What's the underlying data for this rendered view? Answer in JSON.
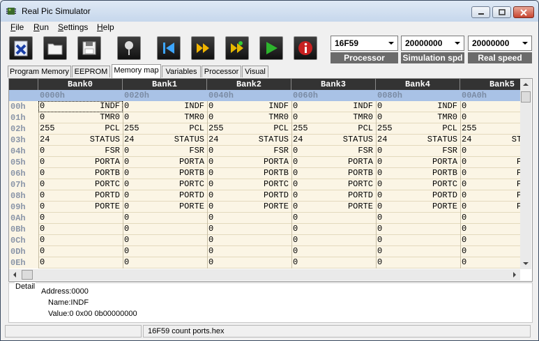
{
  "window": {
    "title": "Real Pic Simulator"
  },
  "menu": [
    {
      "label": "File",
      "accel": "F",
      "rest": "ile"
    },
    {
      "label": "Run",
      "accel": "R",
      "rest": "un"
    },
    {
      "label": "Settings",
      "accel": "S",
      "rest": "ettings"
    },
    {
      "label": "Help",
      "accel": "H",
      "rest": "elp"
    }
  ],
  "toolbar": {
    "buttons": [
      {
        "icon": "close-file-icon"
      },
      {
        "icon": "open-folder-icon"
      },
      {
        "icon": "save-icon"
      },
      {
        "icon": "breakpoint-pin-icon"
      },
      {
        "icon": "reset-icon"
      },
      {
        "icon": "step-forward-icon"
      },
      {
        "icon": "step-over-icon"
      },
      {
        "icon": "run-icon"
      },
      {
        "icon": "info-icon"
      }
    ],
    "processor": {
      "value": "16F59",
      "label": "Processor"
    },
    "sim_speed": {
      "value": "20000000",
      "label": "Simulation spd"
    },
    "real_speed": {
      "value": "20000000",
      "label": "Real speed"
    }
  },
  "tabs": [
    "Program Memory",
    "EEPROM",
    "Memory map",
    "Variables",
    "Processor",
    "Visual"
  ],
  "active_tab": "Memory map",
  "memory_map": {
    "banks": [
      "Bank0",
      "Bank1",
      "Bank2",
      "Bank3",
      "Bank4",
      "Bank5"
    ],
    "bank_addresses": [
      "0000h",
      "0020h",
      "0040h",
      "0060h",
      "0080h",
      "00A0h"
    ],
    "rows": [
      {
        "addr": "00h",
        "value": "0",
        "name": "INDF"
      },
      {
        "addr": "01h",
        "value": "0",
        "name": "TMR0"
      },
      {
        "addr": "02h",
        "value": "255",
        "name": "PCL"
      },
      {
        "addr": "03h",
        "value": "24",
        "name": "STATUS"
      },
      {
        "addr": "04h",
        "value": "0",
        "name": "FSR"
      },
      {
        "addr": "05h",
        "value": "0",
        "name": "PORTA"
      },
      {
        "addr": "06h",
        "value": "0",
        "name": "PORTB"
      },
      {
        "addr": "07h",
        "value": "0",
        "name": "PORTC"
      },
      {
        "addr": "08h",
        "value": "0",
        "name": "PORTD"
      },
      {
        "addr": "09h",
        "value": "0",
        "name": "PORTE"
      },
      {
        "addr": "0Ah",
        "value": "0",
        "name": ""
      },
      {
        "addr": "0Bh",
        "value": "0",
        "name": ""
      },
      {
        "addr": "0Ch",
        "value": "0",
        "name": ""
      },
      {
        "addr": "0Dh",
        "value": "0",
        "name": ""
      },
      {
        "addr": "0Eh",
        "value": "0",
        "name": ""
      }
    ]
  },
  "detail": {
    "title": "Detail",
    "address": "Address:0000",
    "name": "Name:INDF",
    "value": "Value:0 0x00 0b00000000"
  },
  "status": {
    "file": "16F59 count ports.hex"
  }
}
